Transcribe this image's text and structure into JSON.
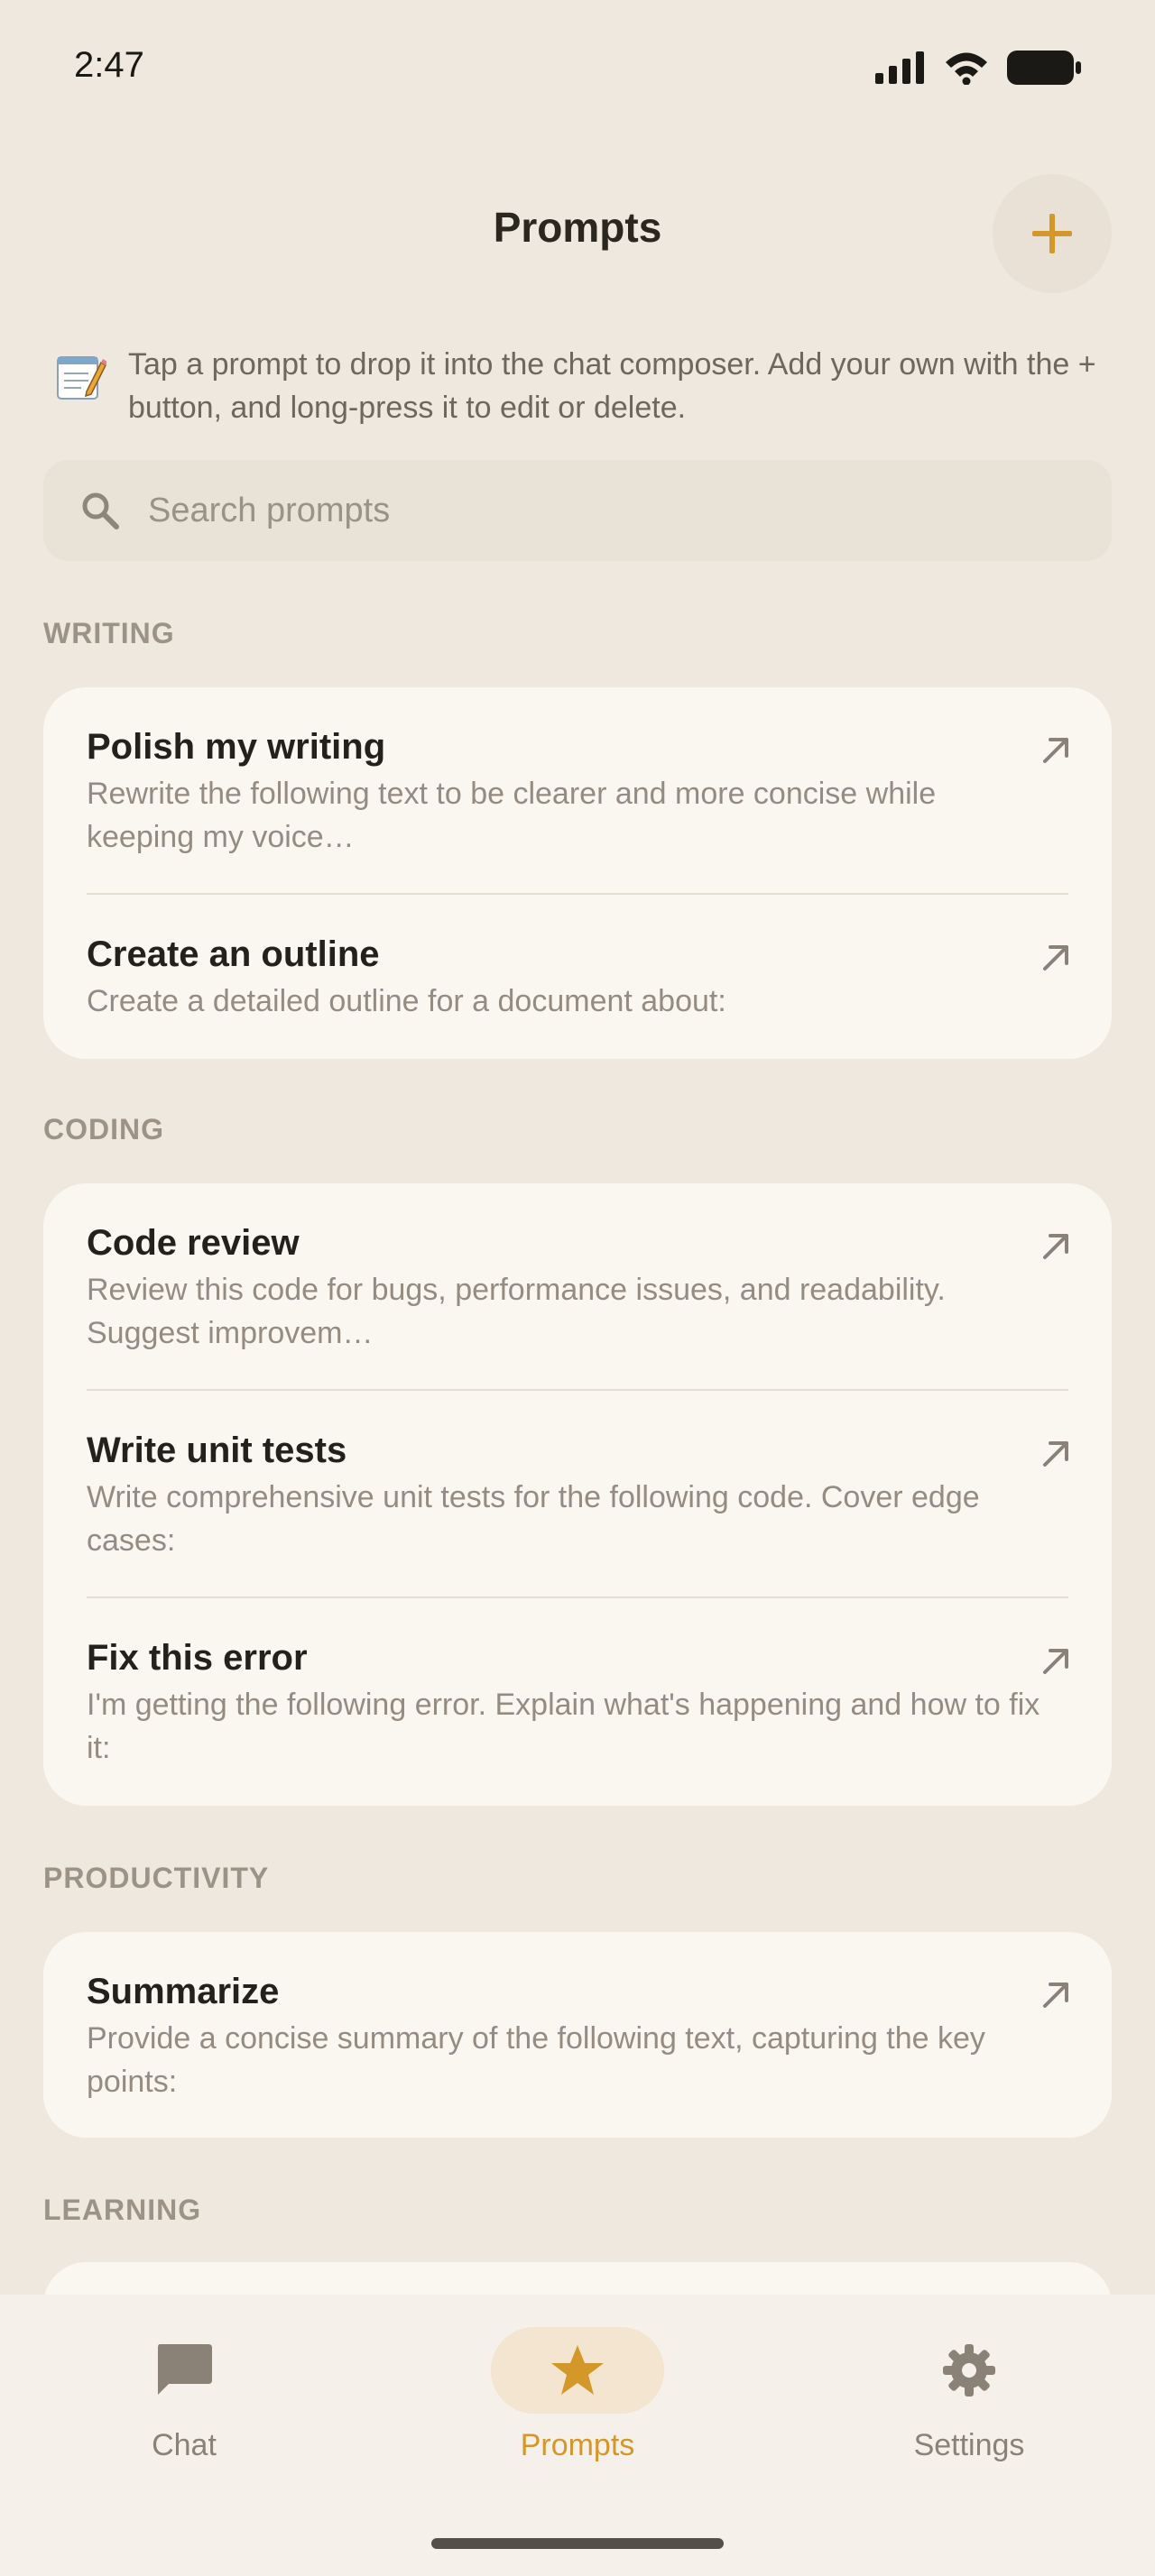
{
  "status_bar": {
    "time": "2:47"
  },
  "header": {
    "title": "Prompts",
    "add_icon": "plus-icon"
  },
  "info": {
    "icon": "memo-icon",
    "text": "Tap a prompt to drop it into the chat composer. Add your own with the + button, and long-press it to edit or delete."
  },
  "search": {
    "placeholder": "Search prompts",
    "value": ""
  },
  "sections": [
    {
      "label": "WRITING",
      "items": [
        {
          "title": "Polish my writing",
          "desc": "Rewrite the following text to be clearer and more concise while keeping my voice…"
        },
        {
          "title": "Create an outline",
          "desc": "Create a detailed outline for a document about:"
        }
      ]
    },
    {
      "label": "CODING",
      "items": [
        {
          "title": "Code review",
          "desc": "Review this code for bugs, performance issues, and readability. Suggest improvem…"
        },
        {
          "title": "Write unit tests",
          "desc": "Write comprehensive unit tests for the following code. Cover edge cases:"
        },
        {
          "title": "Fix this error",
          "desc": "I'm getting the following error. Explain what's happening and how to fix it:"
        }
      ]
    },
    {
      "label": "PRODUCTIVITY",
      "items": [
        {
          "title": "Summarize",
          "desc": "Provide a concise summary of the following text, capturing the key points:"
        }
      ]
    },
    {
      "label": "LEARNING",
      "items": []
    }
  ],
  "nav": {
    "items": [
      {
        "label": "Chat",
        "icon": "chat-bubble-icon",
        "active": false
      },
      {
        "label": "Prompts",
        "icon": "star-icon",
        "active": true
      },
      {
        "label": "Settings",
        "icon": "gear-icon",
        "active": false
      }
    ]
  },
  "colors": {
    "background": "#efe8de",
    "card": "#faf7f1",
    "accent": "#d4982a",
    "text_primary": "#24211c",
    "text_secondary": "#958c81"
  }
}
